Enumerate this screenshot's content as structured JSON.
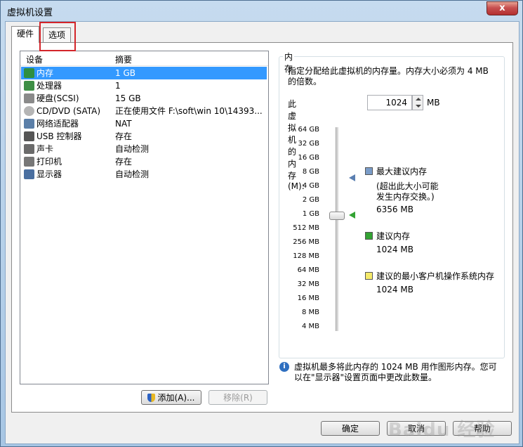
{
  "window": {
    "title": "虚拟机设置",
    "close_glyph": "x"
  },
  "tabs": [
    {
      "label": "硬件"
    },
    {
      "label": "选项"
    }
  ],
  "device_list": {
    "headers": {
      "device": "设备",
      "summary": "摘要"
    },
    "rows": [
      {
        "device": "内存",
        "summary": "1 GB",
        "icon": "memory-icon"
      },
      {
        "device": "处理器",
        "summary": "1",
        "icon": "cpu-icon"
      },
      {
        "device": "硬盘(SCSI)",
        "summary": "15 GB",
        "icon": "harddisk-icon"
      },
      {
        "device": "CD/DVD (SATA)",
        "summary": "正在使用文件 F:\\soft\\win 10\\14393...",
        "icon": "cd-icon"
      },
      {
        "device": "网络适配器",
        "summary": "NAT",
        "icon": "network-icon"
      },
      {
        "device": "USB 控制器",
        "summary": "存在",
        "icon": "usb-icon"
      },
      {
        "device": "声卡",
        "summary": "自动检测",
        "icon": "sound-icon"
      },
      {
        "device": "打印机",
        "summary": "存在",
        "icon": "printer-icon"
      },
      {
        "device": "显示器",
        "summary": "自动检测",
        "icon": "display-icon"
      }
    ],
    "add_label": "添加(A)...",
    "remove_label": "移除(R)"
  },
  "memory": {
    "group_title": "内存",
    "description": "指定分配给此虚拟机的内存量。内存大小必须为 4 MB 的倍数。",
    "field_label": "此虚拟机的内存(M):",
    "value": "1024",
    "unit": "MB",
    "ticks": [
      "64 GB",
      "32 GB",
      "16 GB",
      "8 GB",
      "4 GB",
      "2 GB",
      "1 GB",
      "512 MB",
      "256 MB",
      "128 MB",
      "64 MB",
      "32 MB",
      "16 MB",
      "8 MB",
      "4 MB"
    ],
    "legend": {
      "max_title": "最大建议内存",
      "max_note_1": "(超出此大小可能",
      "max_note_2": "发生内存交换。)",
      "max_value": "6356 MB",
      "rec_title": "建议内存",
      "rec_value": "1024 MB",
      "min_title": "建议的最小客户机操作系统内存",
      "min_value": "1024 MB"
    },
    "info": "虚拟机最多将此内存的 1024 MB 用作图形内存。您可以在\"显示器\"设置页面中更改此数量。"
  },
  "footer": {
    "ok": "确定",
    "cancel": "取消",
    "help": "帮助"
  },
  "watermark": "Baidu 经验",
  "colors": {
    "selection": "#3399ff",
    "max_marker": "#5a7fb1",
    "rec_marker": "#33a333",
    "min_marker": "#f5ea6a",
    "highlight": "#d3252a"
  }
}
